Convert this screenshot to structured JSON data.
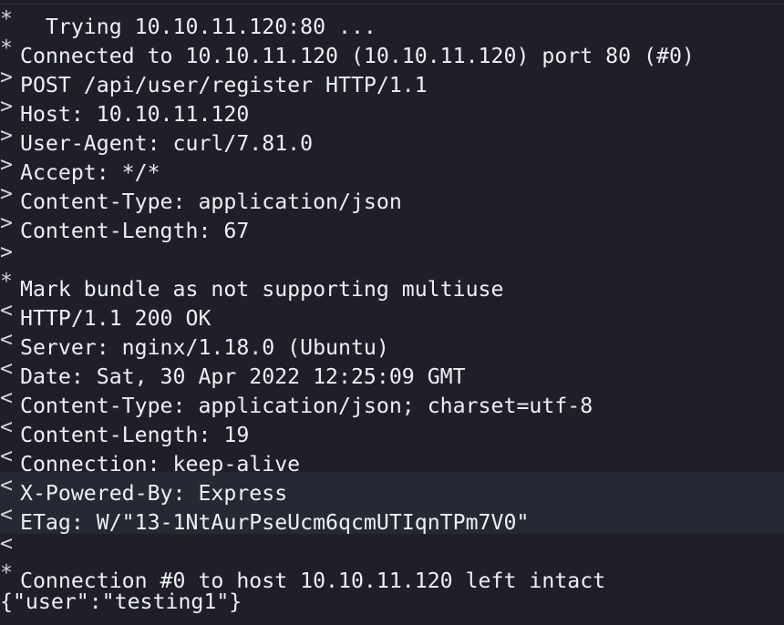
{
  "terminal": {
    "lines": [
      {
        "prefix": "*",
        "text": "  Trying 10.10.11.120:80 ..."
      },
      {
        "prefix": "*",
        "text": "Connected to 10.10.11.120 (10.10.11.120) port 80 (#0)"
      },
      {
        "prefix": ">",
        "text": "POST /api/user/register HTTP/1.1"
      },
      {
        "prefix": ">",
        "text": "Host: 10.10.11.120"
      },
      {
        "prefix": ">",
        "text": "User-Agent: curl/7.81.0"
      },
      {
        "prefix": ">",
        "text": "Accept: */*"
      },
      {
        "prefix": ">",
        "text": "Content-Type: application/json"
      },
      {
        "prefix": ">",
        "text": "Content-Length: 67"
      },
      {
        "prefix": ">",
        "text": ""
      },
      {
        "prefix": "*",
        "text": "Mark bundle as not supporting multiuse"
      },
      {
        "prefix": "<",
        "text": "HTTP/1.1 200 OK"
      },
      {
        "prefix": "<",
        "text": "Server: nginx/1.18.0 (Ubuntu)"
      },
      {
        "prefix": "<",
        "text": "Date: Sat, 30 Apr 2022 12:25:09 GMT"
      },
      {
        "prefix": "<",
        "text": "Content-Type: application/json; charset=utf-8"
      },
      {
        "prefix": "<",
        "text": "Content-Length: 19"
      },
      {
        "prefix": "<",
        "text": "Connection: keep-alive"
      },
      {
        "prefix": "<",
        "text": "X-Powered-By: Express"
      },
      {
        "prefix": "<",
        "text": "ETag: W/\"13-1NtAurPseUcm6qcmUTIqnTPm7V0\""
      },
      {
        "prefix": "<",
        "text": ""
      },
      {
        "prefix": "*",
        "text": "Connection #0 to host 10.10.11.120 left intact"
      },
      {
        "prefix": "",
        "text": "{\"user\":\"testing1\"}"
      }
    ]
  },
  "colors": {
    "background": "#1e1f29",
    "foreground": "#eef0f2",
    "highlight": "#262833"
  }
}
